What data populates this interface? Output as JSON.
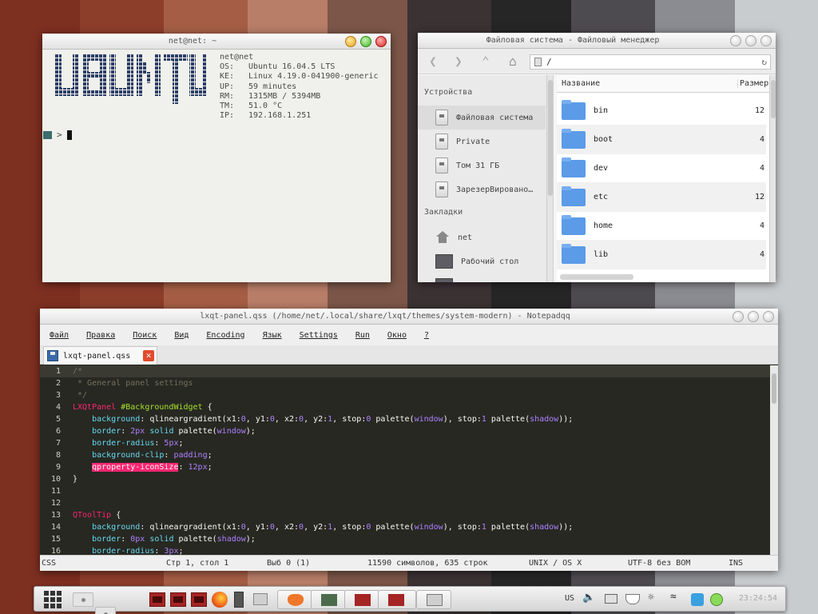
{
  "terminal": {
    "title": "net@net: ~",
    "user_host": "net@net",
    "info": [
      {
        "key": "OS:",
        "value": "Ubuntu 16.04.5 LTS"
      },
      {
        "key": "KE:",
        "value": "Linux 4.19.0-041900-generic"
      },
      {
        "key": "UP:",
        "value": "59 minutes"
      },
      {
        "key": "RM:",
        "value": "1315MB / 5394MB"
      },
      {
        "key": "TM:",
        "value": "51.0 °C"
      },
      {
        "key": "IP:",
        "value": "192.168.1.251"
      }
    ],
    "prompt_symbol": ">",
    "logo_text": "UBUNTU"
  },
  "file_manager": {
    "title": "Файловая система - Файловый менеджер",
    "path": "/",
    "sidebar": {
      "devices_header": "Устройства",
      "devices": [
        "Файловая система",
        "Private",
        "Том 31 ГБ",
        "ЗарезерВировано…"
      ],
      "bookmarks_header": "Закладки",
      "bookmarks": [
        "net",
        "Рабочий стол",
        "…"
      ]
    },
    "columns": {
      "name": "Название",
      "size": "Размер"
    },
    "files": [
      {
        "name": "bin",
        "size": "12"
      },
      {
        "name": "boot",
        "size": "4"
      },
      {
        "name": "dev",
        "size": "4"
      },
      {
        "name": "etc",
        "size": "12"
      },
      {
        "name": "home",
        "size": "4"
      },
      {
        "name": "lib",
        "size": "4"
      }
    ]
  },
  "editor": {
    "title": "lxqt-panel.qss (/home/net/.local/share/lxqt/themes/system-modern) - Notepadqq",
    "menu": [
      "Файл",
      "Правка",
      "Поиск",
      "Вид",
      "Encoding",
      "Язык",
      "Settings",
      "Run",
      "Окно",
      "?"
    ],
    "tab_name": "lxqt-panel.qss",
    "lines": [
      {
        "n": "1",
        "text": "/*"
      },
      {
        "n": "2",
        "text": " * General panel settings"
      },
      {
        "n": "3",
        "text": " */"
      },
      {
        "n": "4",
        "text": "LXQtPanel #BackgroundWidget {"
      },
      {
        "n": "5",
        "text": "    background: qlineargradient(x1:0, y1:0, x2:0, y2:1, stop:0 palette(window), stop:1 palette(shadow));"
      },
      {
        "n": "6",
        "text": "    border: 2px solid palette(window);"
      },
      {
        "n": "7",
        "text": "    border-radius: 5px;"
      },
      {
        "n": "8",
        "text": "    background-clip: padding;"
      },
      {
        "n": "9",
        "text": "    qproperty-iconSize: 12px;"
      },
      {
        "n": "10",
        "text": "}"
      },
      {
        "n": "11",
        "text": ""
      },
      {
        "n": "12",
        "text": ""
      },
      {
        "n": "13",
        "text": "QToolTip {"
      },
      {
        "n": "14",
        "text": "    background: qlineargradient(x1:0, y1:0, x2:0, y2:1, stop:0 palette(window), stop:1 palette(shadow));"
      },
      {
        "n": "15",
        "text": "    border: 0px solid palette(shadow);"
      },
      {
        "n": "16",
        "text": "    border-radius: 3px;"
      }
    ],
    "status": {
      "language": "CSS",
      "position": "Стр 1, стол 1",
      "selection": "Выб 0 (1)",
      "counts": "11590 символов, 635 строк",
      "eol": "UNIX / OS X",
      "encoding": "UTF-8 без BOM",
      "mode": "INS"
    }
  },
  "panel": {
    "keyboard_layout": "US",
    "clock": "23:24:54"
  },
  "colors": {
    "editor_bg": "#272822",
    "selector": "#f92672",
    "identifier": "#a6e22e",
    "property": "#66d9ef",
    "number": "#ae81ff",
    "comment": "#75715e",
    "folder": "#5b9be8"
  }
}
